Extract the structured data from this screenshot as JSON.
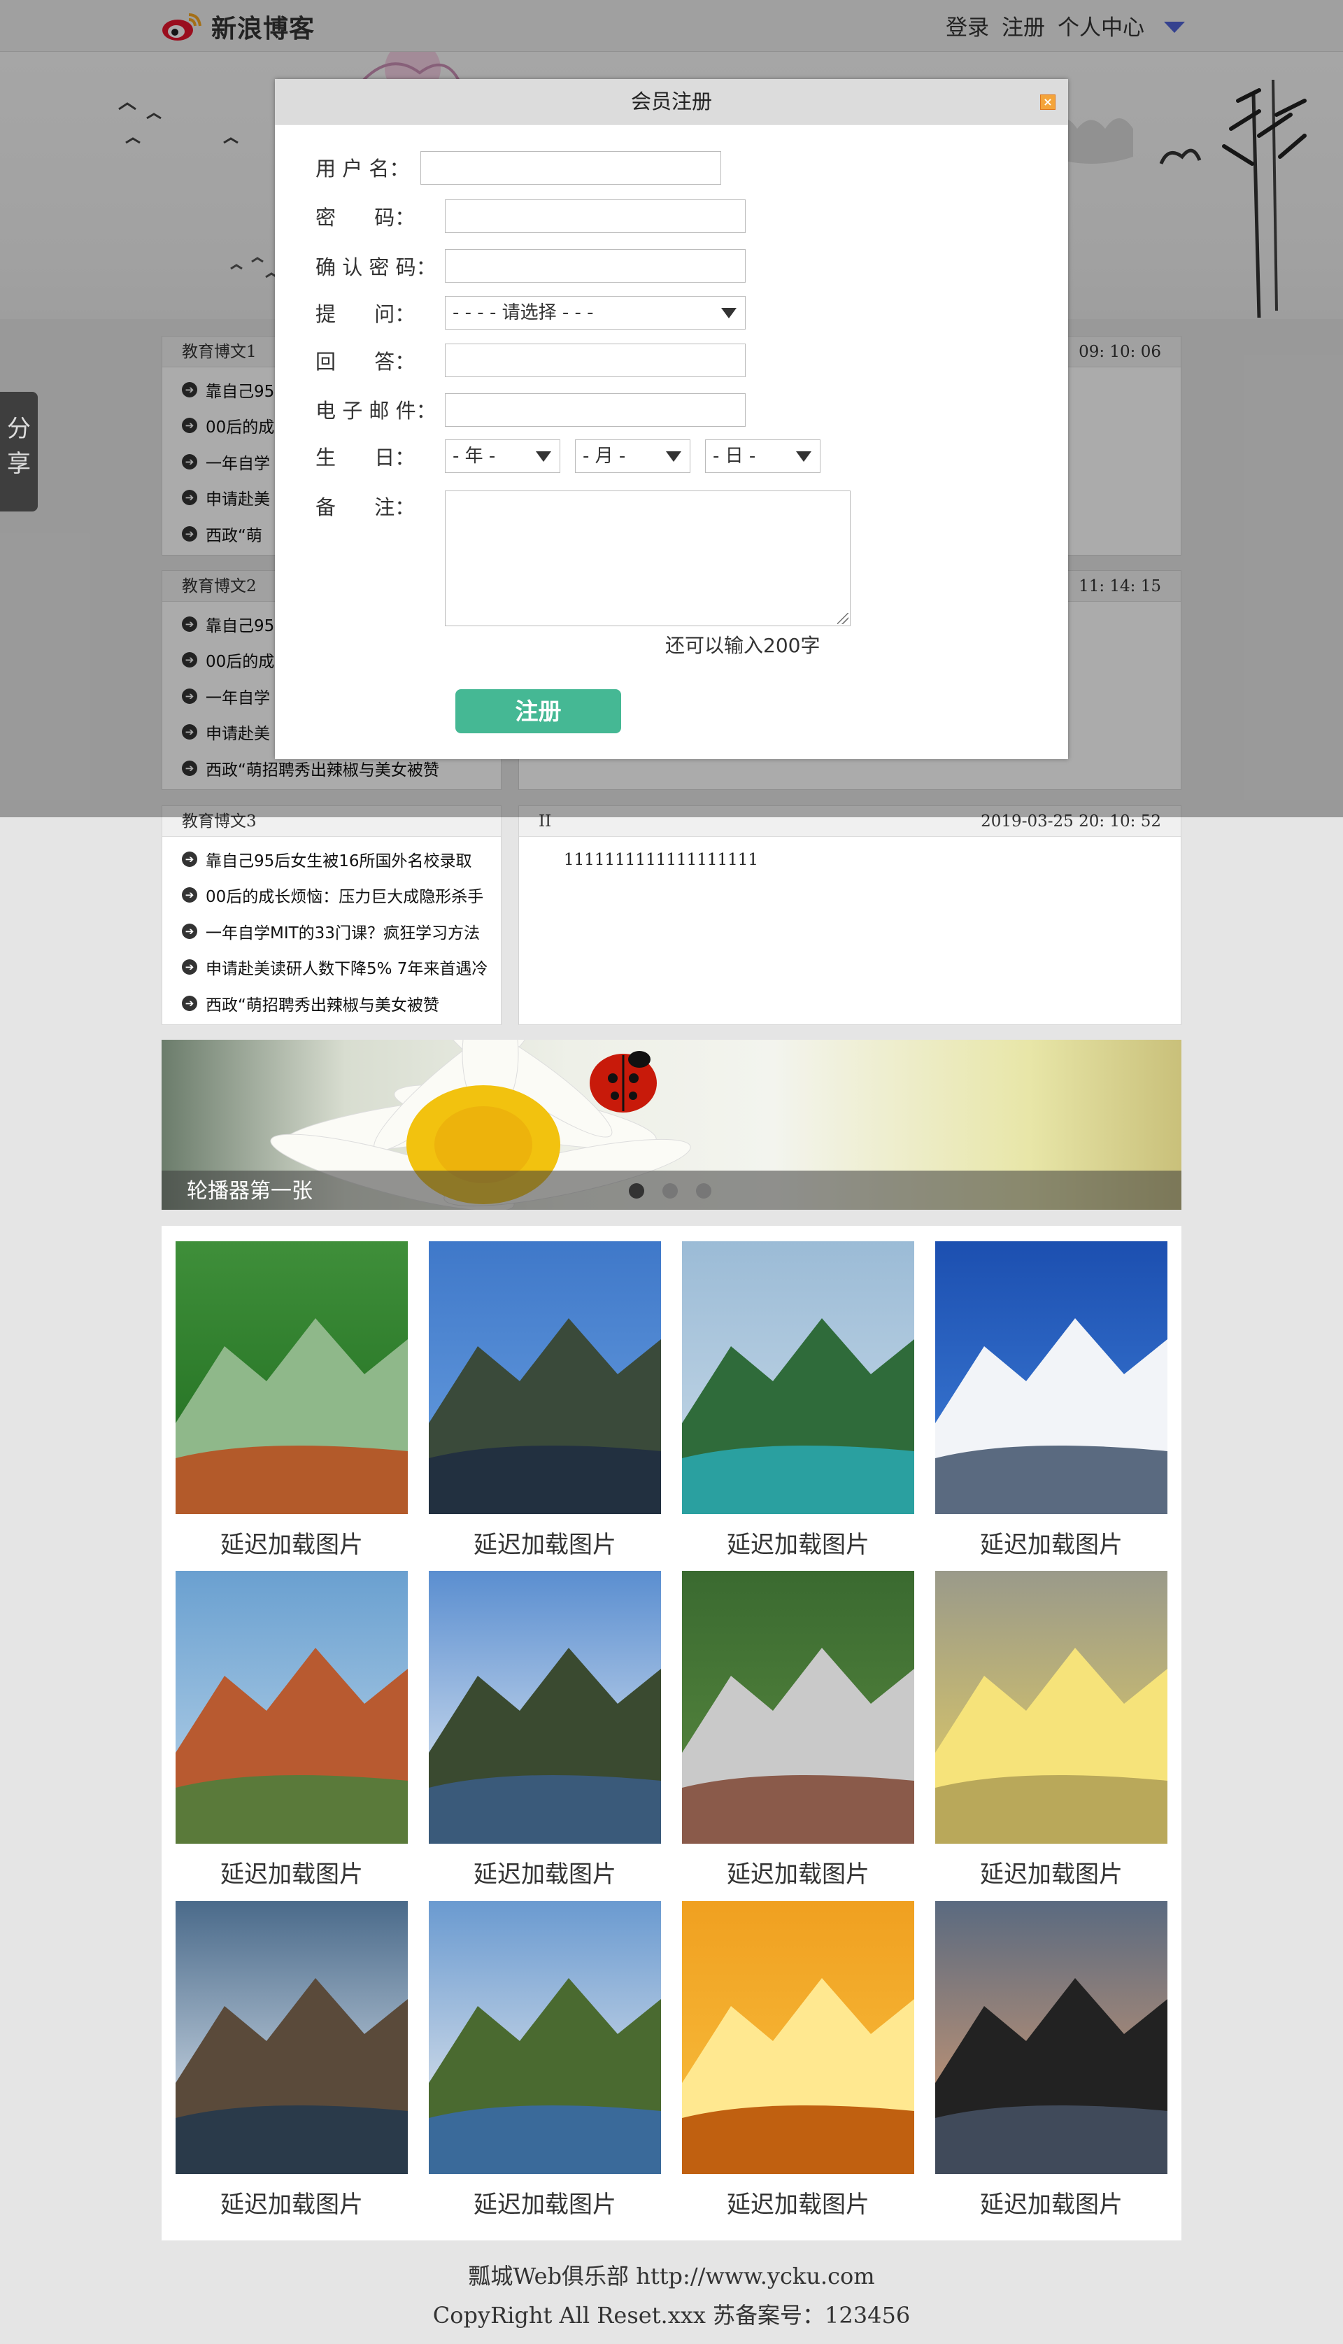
{
  "header": {
    "logo_text": "新浪博客",
    "nav": [
      "登录",
      "注册",
      "个人中心"
    ]
  },
  "share_tab": {
    "label1": "分",
    "label2": "享"
  },
  "sections": [
    {
      "title": "教育博文1",
      "timestamp": "09: 10: 06",
      "items": [
        "靠自己95",
        "00后的成",
        "一年自学",
        "申请赴美",
        "西政“萌"
      ]
    },
    {
      "title": "教育博文2",
      "timestamp": "11: 14: 15",
      "items": [
        "靠自己95",
        "00后的成",
        "一年自学",
        "申请赴美",
        "西政“萌招聘秀出辣椒与美女被赞"
      ]
    },
    {
      "title": "教育博文3",
      "right_title": "II",
      "timestamp": "2019-03-25 20: 10: 52",
      "content": "1111111111111111111",
      "items": [
        "靠自己95后女生被16所国外名校录取",
        "00后的成长烦恼：压力巨大成隐形杀手",
        "一年自学MIT的33门课？疯狂学习方法",
        "申请赴美读研人数下降5% 7年来首遇冷",
        "西政“萌招聘秀出辣椒与美女被赞"
      ]
    }
  ],
  "carousel": {
    "caption": "轮播器第一张",
    "active_index": 0,
    "slide_count": 3
  },
  "gallery": {
    "caption": "延迟加载图片",
    "items": [
      {
        "icon": "house-forest-image"
      },
      {
        "icon": "karst-lake-image"
      },
      {
        "icon": "lake-island-image"
      },
      {
        "icon": "snow-mountain-image"
      },
      {
        "icon": "red-cliff-image"
      },
      {
        "icon": "pavilion-lake-image"
      },
      {
        "icon": "village-image"
      },
      {
        "icon": "golden-sky-image"
      },
      {
        "icon": "snow-river-image"
      },
      {
        "icon": "green-hills-image"
      },
      {
        "icon": "sunset-sea-image"
      },
      {
        "icon": "tree-silhouette-image"
      }
    ]
  },
  "footer": {
    "line1": "瓢城Web俱乐部 http://www.ycku.com",
    "line2": "CopyRight All Reset.xxx 苏备案号：123456"
  },
  "dialog": {
    "title": "会员注册",
    "close": "×",
    "labels": {
      "username": "用 户 名：",
      "password": "密      码：",
      "confirm": "确 认 密 码：",
      "question": "提      问：",
      "answer": "回      答：",
      "email": "电 子 邮 件：",
      "birthday": "生      日：",
      "note": "备      注："
    },
    "question_select": "- - - - 请选择 - - -",
    "year_select": "- 年 -",
    "month_select": "- 月 -",
    "day_select": "- 日 -",
    "hint": "还可以输入200字",
    "submit": "注册"
  }
}
